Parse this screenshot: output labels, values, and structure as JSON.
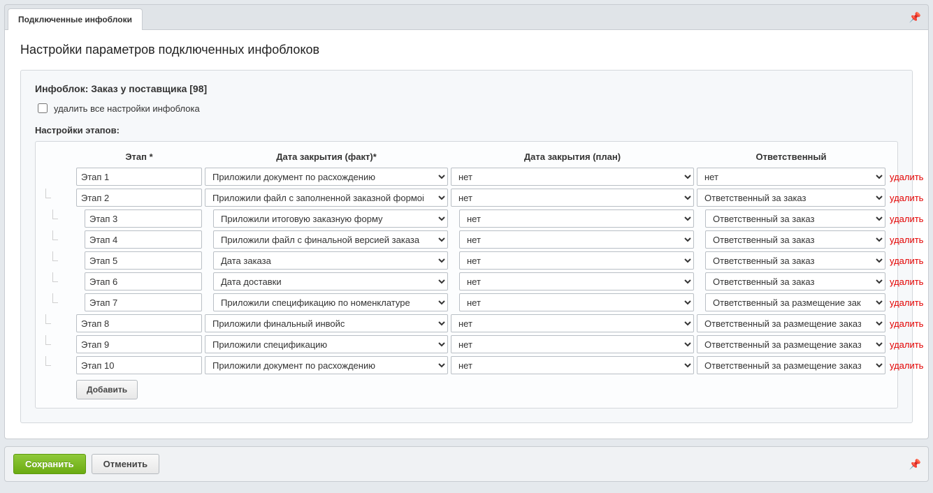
{
  "tab_label": "Подключенные инфоблоки",
  "panel_title": "Настройки параметров подключенных инфоблоков",
  "iblock_title": "Инфоблок: Заказ у поставщика [98]",
  "delete_all_label": "удалить все настройки инфоблока",
  "stages_label": "Настройки этапов:",
  "columns": {
    "stage": "Этап *",
    "close_fact": "Дата закрытия (факт)*",
    "close_plan": "Дата закрытия (план)",
    "responsible": "Ответственный"
  },
  "delete_label": "удалить",
  "add_button": "Добавить",
  "save_button": "Сохранить",
  "cancel_button": "Отменить",
  "rows": [
    {
      "indent": 0,
      "stage": "Этап 1",
      "close_fact": "Приложили документ по расхождению",
      "close_plan": "нет",
      "responsible": "нет"
    },
    {
      "indent": 1,
      "stage": "Этап 2",
      "close_fact": "Приложили файл с заполненной заказной формой",
      "close_plan": "нет",
      "responsible": "Ответственный за заказ"
    },
    {
      "indent": 2,
      "stage": "Этап 3",
      "close_fact": "Приложили итоговую заказную форму",
      "close_plan": "нет",
      "responsible": "Ответственный за заказ"
    },
    {
      "indent": 2,
      "stage": "Этап 4",
      "close_fact": "Приложили файл с финальной версией заказа",
      "close_plan": "нет",
      "responsible": "Ответственный за заказ"
    },
    {
      "indent": 2,
      "stage": "Этап 5",
      "close_fact": "Дата заказа",
      "close_plan": "нет",
      "responsible": "Ответственный за заказ"
    },
    {
      "indent": 2,
      "stage": "Этап 6",
      "close_fact": "Дата доставки",
      "close_plan": "нет",
      "responsible": "Ответственный за заказ"
    },
    {
      "indent": 2,
      "stage": "Этап 7",
      "close_fact": "Приложили спецификацию по номенклатуре",
      "close_plan": "нет",
      "responsible": "Ответственный за размещение заказа!"
    },
    {
      "indent": 1,
      "stage": "Этап 8",
      "close_fact": "Приложили финальный инвойс",
      "close_plan": "нет",
      "responsible": "Ответственный за размещение заказа!"
    },
    {
      "indent": 1,
      "stage": "Этап 9",
      "close_fact": "Приложили спецификацию",
      "close_plan": "нет",
      "responsible": "Ответственный за размещение заказа!"
    },
    {
      "indent": 1,
      "stage": "Этап 10",
      "close_fact": "Приложили документ по расхождению",
      "close_plan": "нет",
      "responsible": "Ответственный за размещение заказа!"
    }
  ]
}
